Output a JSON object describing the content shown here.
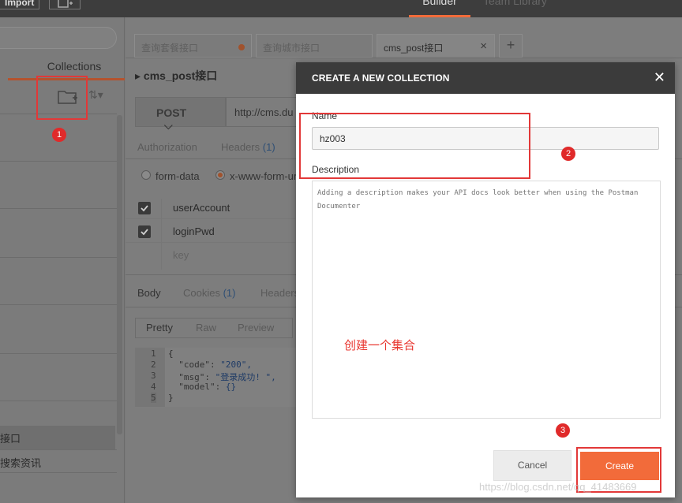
{
  "topbar": {
    "import_label": "Import",
    "tabs": [
      {
        "label": "Builder",
        "active": true
      },
      {
        "label": "Team Library",
        "active": false
      }
    ]
  },
  "sidebar": {
    "tab_label": "Collections",
    "items": [
      {
        "label": "接口",
        "selected": true
      },
      {
        "label": "搜索资讯",
        "selected": false
      }
    ]
  },
  "request_tabs": [
    {
      "label": "查询套餐接口",
      "unsaved": true,
      "active": false
    },
    {
      "label": "查询城市接口",
      "unsaved": false,
      "active": false
    },
    {
      "label": "cms_post接口",
      "unsaved": false,
      "active": true
    }
  ],
  "request": {
    "breadcrumb": "cms_post接口",
    "method": "POST",
    "url": "http://cms.du",
    "sub_tabs": {
      "authorization": "Authorization",
      "headers": "Headers",
      "headers_count": "(1)"
    },
    "body_types": [
      {
        "label": "form-data",
        "selected": false
      },
      {
        "label": "x-www-form-ur",
        "selected": true
      }
    ],
    "params": [
      {
        "key": "userAccount",
        "checked": true
      },
      {
        "key": "loginPwd",
        "checked": true
      },
      {
        "key": "key",
        "placeholder": true
      }
    ]
  },
  "response": {
    "tabs": {
      "body": "Body",
      "cookies": "Cookies",
      "cookies_count": "(1)",
      "headers": "Headers"
    },
    "view_modes": [
      "Pretty",
      "Raw",
      "Preview"
    ],
    "line_numbers": [
      "1",
      "2",
      "3",
      "4",
      "5"
    ],
    "code": [
      {
        "text": "{"
      },
      {
        "key": "\"code\": ",
        "value": "\"200\","
      },
      {
        "key": "\"msg\": ",
        "value": "\"登录成功! \","
      },
      {
        "key": "\"model\": ",
        "value": "{}"
      },
      {
        "text": "}"
      }
    ]
  },
  "modal": {
    "title": "CREATE A NEW COLLECTION",
    "close_icon": "close-icon",
    "name_label": "Name",
    "name_value": "hz003",
    "description_label": "Description",
    "description_placeholder": "Adding a description makes your API docs look better when using the Postman Documenter",
    "cancel_label": "Cancel",
    "create_label": "Create"
  },
  "annotations": {
    "badges": [
      "1",
      "2",
      "3"
    ],
    "note": "创建一个集合",
    "color": "#e23838"
  },
  "watermark": "https://blog.csdn.net/qq_41483669",
  "colors": {
    "accent": "#f26b3a",
    "modal_header": "#3b3b3b"
  }
}
